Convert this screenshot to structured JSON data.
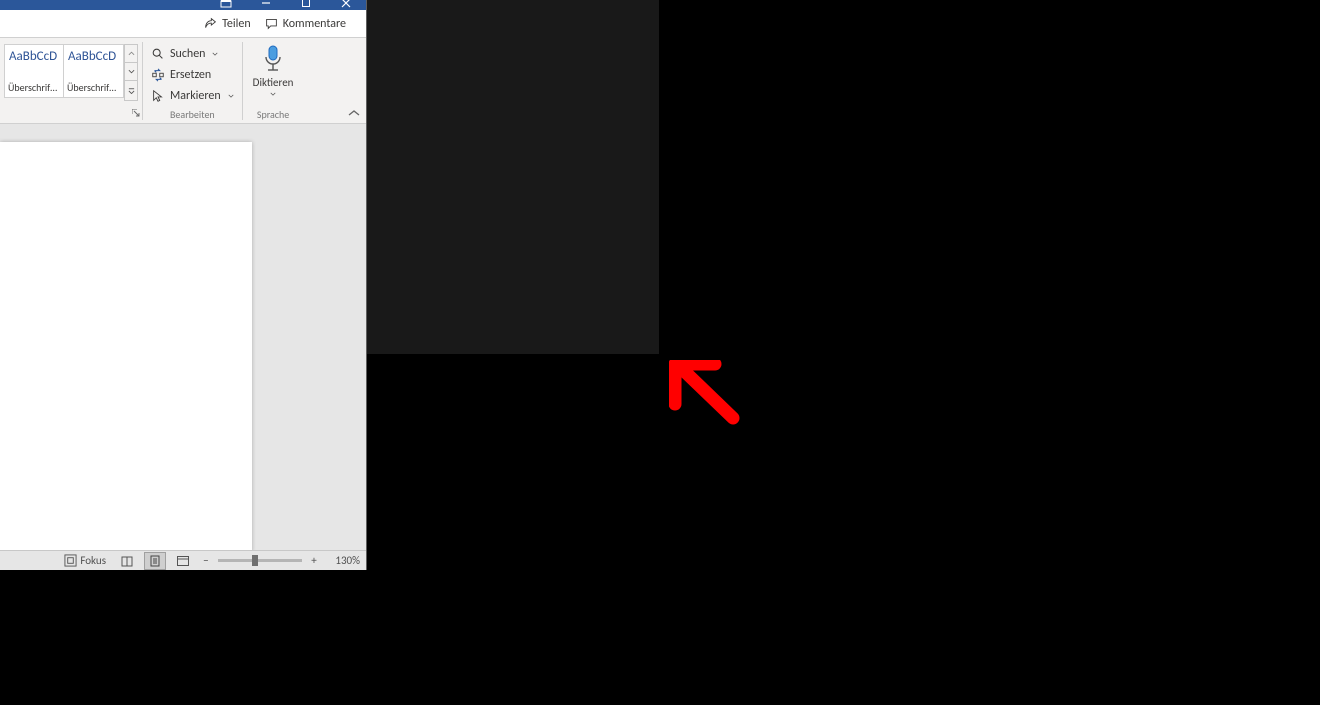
{
  "titlebar": {
    "share_label": "Teilen",
    "comments_label": "Kommentare"
  },
  "ribbon": {
    "styles": {
      "group_label": "",
      "tiles": [
        {
          "sample": "AaBbCcD",
          "name": "Überschrif…"
        },
        {
          "sample": "AaBbCcD",
          "name": "Überschrif…"
        }
      ]
    },
    "editing": {
      "group_label": "Bearbeiten",
      "search_label": "Suchen",
      "replace_label": "Ersetzen",
      "select_label": "Markieren"
    },
    "voice": {
      "group_label": "Sprache",
      "dictate_label": "Diktieren"
    }
  },
  "statusbar": {
    "focus_label": "Fokus",
    "zoom_label": "130%"
  }
}
